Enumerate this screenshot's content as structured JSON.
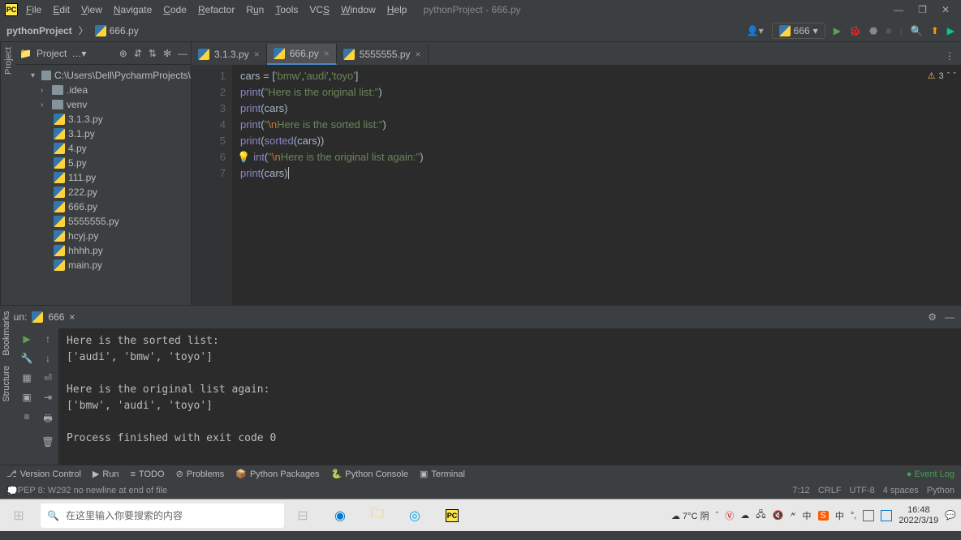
{
  "title": {
    "project": "pythonProject",
    "file": "666.py"
  },
  "menu": [
    "File",
    "Edit",
    "View",
    "Navigate",
    "Code",
    "Refactor",
    "Run",
    "Tools",
    "VCS",
    "Window",
    "Help"
  ],
  "crumbs": {
    "root": "pythonProject",
    "file": "666.py"
  },
  "runconfig": "666",
  "projectPanel": {
    "label": "Project",
    "root": "C:\\Users\\Dell\\PycharmProjects\\",
    "folders": [
      ".idea",
      "venv"
    ],
    "files": [
      "3.1.3.py",
      "3.1.py",
      "4.py",
      "5.py",
      "111.py",
      "222.py",
      "666.py",
      "5555555.py",
      "hcyj.py",
      "hhhh.py",
      "main.py"
    ]
  },
  "tabs": [
    {
      "name": "3.1.3.py",
      "active": false
    },
    {
      "name": "666.py",
      "active": true
    },
    {
      "name": "5555555.py",
      "active": false
    }
  ],
  "code": {
    "lines": [
      1,
      2,
      3,
      4,
      5,
      6,
      7
    ],
    "l1a": "cars = [",
    "l1b": "'bmw'",
    "l1c": ",",
    "l1d": "'audi'",
    "l1e": ",",
    "l1f": "'toyo'",
    "l1g": "]",
    "l2a": "print",
    "l2b": "(",
    "l2c": "\"Here is the original list:\"",
    "l2d": ")",
    "l3a": "print",
    "l3b": "(cars)",
    "l4a": "print",
    "l4b": "(",
    "l4c": "\"",
    "l4d": "\\n",
    "l4e": "Here is the sorted list:\"",
    "l4f": ")",
    "l5a": "print",
    "l5b": "(",
    "l5c": "sorted",
    "l5d": "(cars))",
    "l6a": "print",
    "l6b": "(",
    "l6c": "\"",
    "l6d": "\\n",
    "l6e": "Here is the original list again:\"",
    "l6f": ")",
    "l7a": "print",
    "l7b": "(cars)"
  },
  "warnings": "3",
  "run": {
    "label": "Run:",
    "name": "666",
    "output": "Here is the sorted list:\n['audi', 'bmw', 'toyo']\n\nHere is the original list again:\n['bmw', 'audi', 'toyo']\n\nProcess finished with exit code 0"
  },
  "bottomTabs": [
    "Version Control",
    "Run",
    "TODO",
    "Problems",
    "Python Packages",
    "Python Console",
    "Terminal"
  ],
  "eventLog": "Event Log",
  "statusMsg": "PEP 8: W292 no newline at end of file",
  "status": {
    "pos": "7:12",
    "le": "CRLF",
    "enc": "UTF-8",
    "indent": "4 spaces",
    "interp": "Python"
  },
  "weather": "7°C 阴",
  "searchPlaceholder": "在这里输入你要搜索的内容",
  "clock": {
    "time": "16:48",
    "date": "2022/3/19"
  },
  "sidebarLabels": {
    "project": "Project",
    "structure": "Structure",
    "bookmarks": "Bookmarks"
  }
}
